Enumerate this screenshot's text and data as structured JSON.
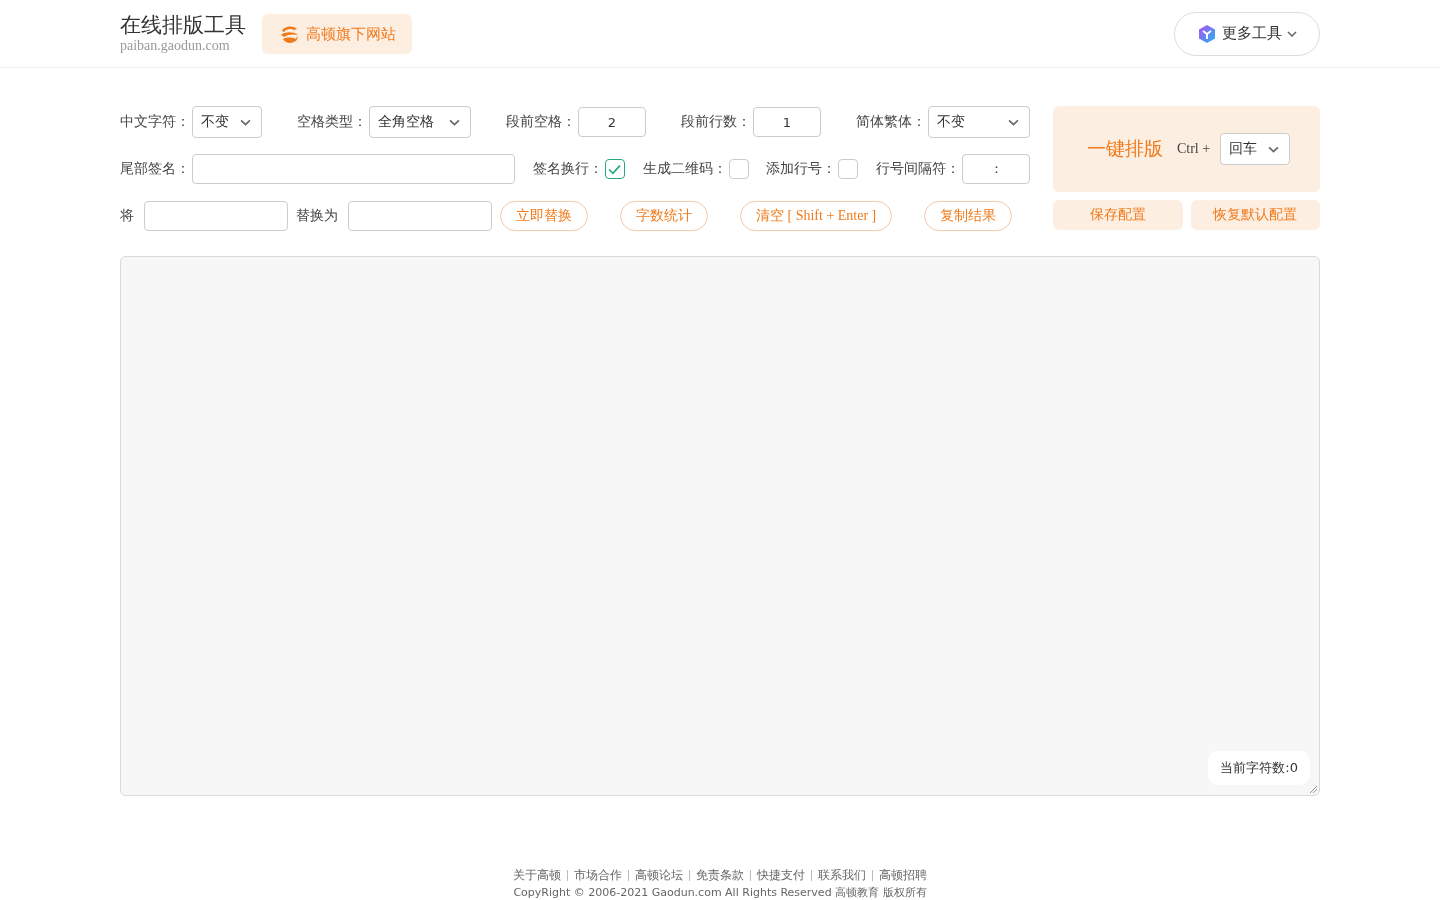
{
  "header": {
    "title": "在线排版工具",
    "domain": "paiban.gaodun.com",
    "brand_button": "高顿旗下网站",
    "more_tools": "更多工具"
  },
  "options_rows": [
    [
      {
        "kind": "select",
        "label": "中文字符：",
        "value": "不变"
      },
      {
        "kind": "select",
        "label": "空格类型：",
        "value": "全角空格"
      },
      {
        "kind": "input",
        "label": "段前空格：",
        "value": "2"
      },
      {
        "kind": "input",
        "label": "段前行数：",
        "value": "1"
      },
      {
        "kind": "select",
        "label": "简体繁体：",
        "value": "不变"
      }
    ],
    [
      {
        "kind": "input",
        "label": "尾部签名："
      },
      {
        "kind": "checkbox",
        "label": "签名换行：",
        "checked": true
      },
      {
        "kind": "checkbox",
        "label": "生成二维码：",
        "checked": false
      },
      {
        "kind": "checkbox",
        "label": "添加行号：",
        "checked": false
      },
      {
        "kind": "input",
        "label": "行号间隔符：",
        "value": "："
      }
    ]
  ],
  "replace": {
    "from_label": "将",
    "to_label": "替换为",
    "buttons": [
      "立即替换",
      "字数统计",
      "清空 [ Shift + Enter ]",
      "复制结果"
    ]
  },
  "format_panel": {
    "action": "一键排版",
    "shortcut": "Ctrl +",
    "key": "回车",
    "buttons": [
      "保存配置",
      "恢复默认配置"
    ]
  },
  "editor": {
    "char_count": "当前字符数:0"
  },
  "footer": {
    "links": [
      "关于高顿",
      "市场合作",
      "高顿论坛",
      "免责条款",
      "快捷支付",
      "联系我们",
      "高顿招聘"
    ],
    "copyright": "CopyRight © 2006-2021 Gaodun.com All Rights Reserved 高顿教育 版权所有"
  }
}
